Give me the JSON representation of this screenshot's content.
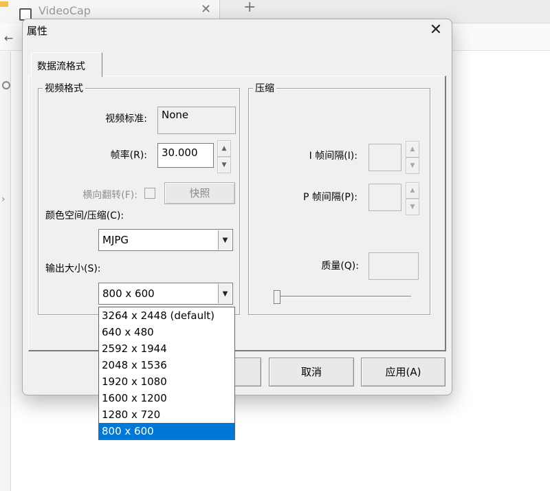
{
  "background_app": {
    "tab_title": "VideoCap",
    "new_tab_glyph": "+",
    "close_glyph": "✕",
    "back_glyph": "←"
  },
  "dialog": {
    "title": "属性",
    "close_glyph": "✕",
    "tab_label": "数据流格式",
    "video_format": {
      "group_title": "视频格式",
      "standard_label": "视频标准:",
      "standard_value": "None",
      "framerate_label": "帧率(R):",
      "framerate_value": "30.000",
      "flip_label": "横向翻转(F):",
      "snapshot_label": "快照",
      "colorspace_label": "颜色空间/压缩(C):",
      "colorspace_value": "MJPG",
      "output_size_label": "输出大小(S):",
      "output_size_value": "800 x 600"
    },
    "compression": {
      "group_title": "压缩",
      "i_frame_label": "I 帧间隔(I):",
      "p_frame_label": "P 帧间隔(P):",
      "quality_label": "质量(Q):"
    },
    "buttons": {
      "cancel": "取消",
      "apply": "应用(A)"
    },
    "output_size_options": [
      "3264 x 2448  (default)",
      "640 x 480",
      "2592 x 1944",
      "2048 x 1536",
      "1920 x 1080",
      "1600 x 1200",
      "1280 x 720",
      "800 x 600"
    ],
    "selected_option": "800 x 600"
  },
  "colors": {
    "selection": "#0078d7",
    "dialog_bg": "#f0f0f0"
  }
}
